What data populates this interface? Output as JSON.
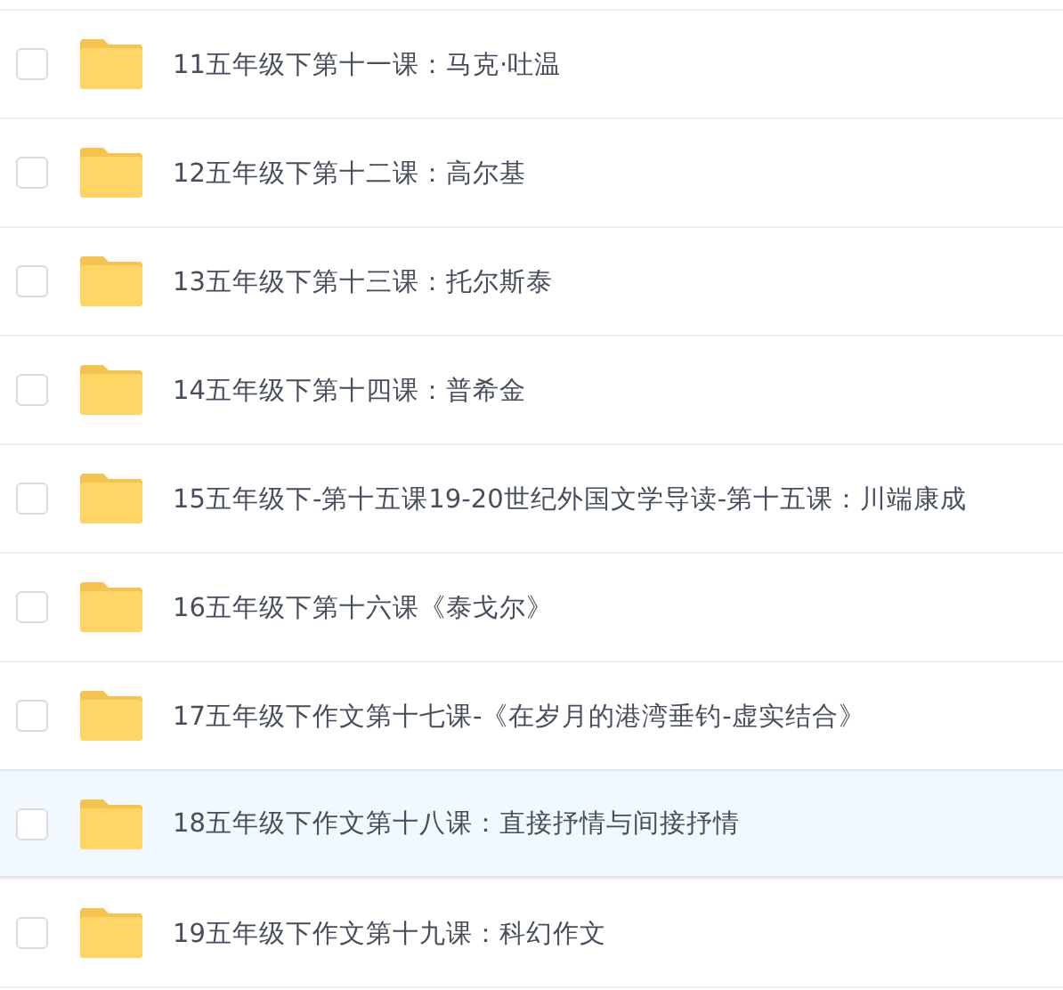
{
  "files": [
    {
      "name": "11五年级下第十一课：马克·吐温",
      "checked": false,
      "highlighted": false
    },
    {
      "name": "12五年级下第十二课：高尔基",
      "checked": false,
      "highlighted": false
    },
    {
      "name": "13五年级下第十三课：托尔斯泰",
      "checked": false,
      "highlighted": false
    },
    {
      "name": "14五年级下第十四课：普希金",
      "checked": false,
      "highlighted": false
    },
    {
      "name": "15五年级下-第十五课19-20世纪外国文学导读-第十五课：川端康成",
      "checked": false,
      "highlighted": false
    },
    {
      "name": "16五年级下第十六课《泰戈尔》",
      "checked": false,
      "highlighted": false
    },
    {
      "name": "17五年级下作文第十七课-《在岁月的港湾垂钓-虚实结合》",
      "checked": false,
      "highlighted": false
    },
    {
      "name": "18五年级下作文第十八课：直接抒情与间接抒情",
      "checked": false,
      "highlighted": true
    },
    {
      "name": "19五年级下作文第十九课：科幻作文",
      "checked": false,
      "highlighted": false
    }
  ]
}
